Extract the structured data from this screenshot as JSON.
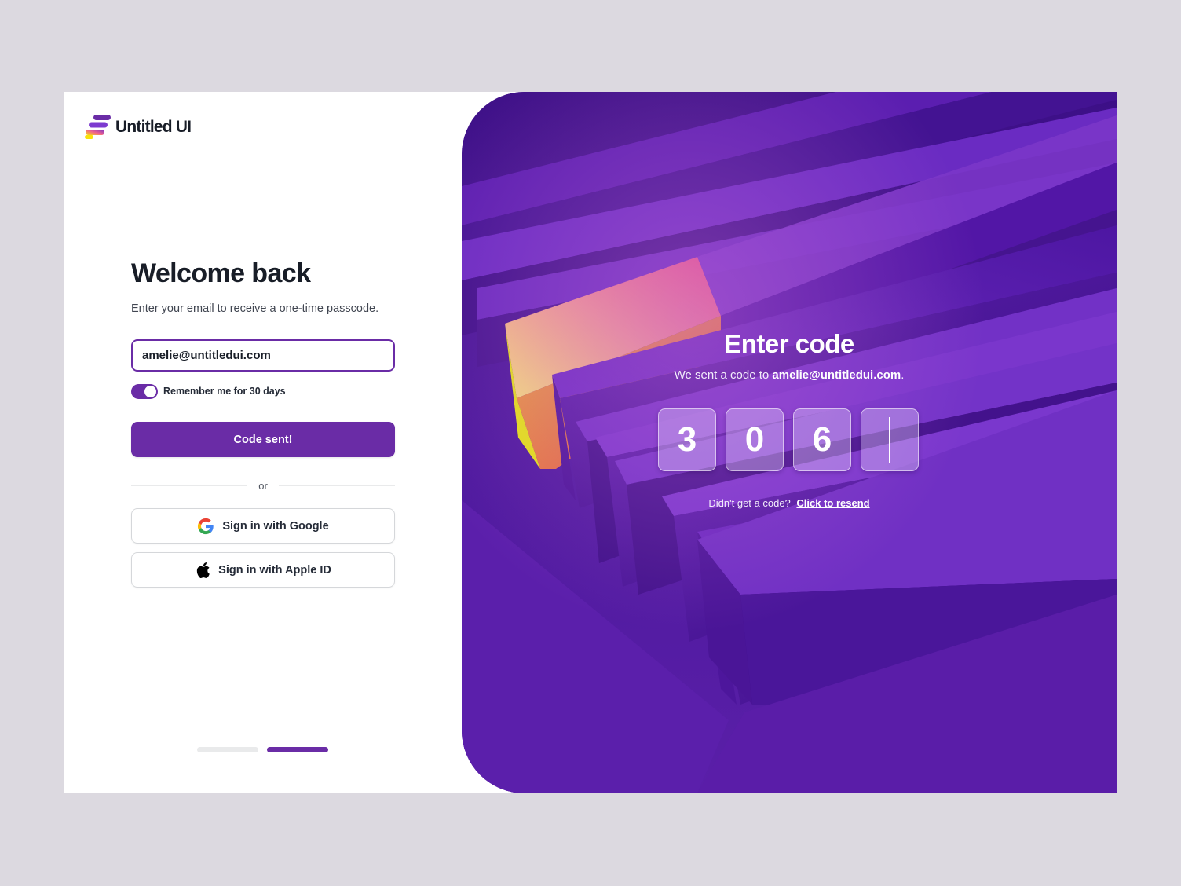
{
  "brand": {
    "name": "Untitled UI",
    "accent": "#6a2ca6"
  },
  "login": {
    "title": "Welcome back",
    "subtitle": "Enter your email to receive a one-time passcode.",
    "email_value": "amelie@untitledui.com",
    "remember_label": "Remember me for 30 days",
    "remember_on": true,
    "submit_label": "Code sent!",
    "divider_text": "or",
    "google_label": "Sign in with Google",
    "apple_label": "Sign in with Apple ID",
    "icons": [
      "google-logo-icon",
      "apple-logo-icon"
    ]
  },
  "pager": {
    "total": 2,
    "active_index": 1
  },
  "verify": {
    "title": "Enter code",
    "subtitle_prefix": "We sent a code to",
    "subtitle_email": "amelie@untitledui.com",
    "subtitle_suffix": ".",
    "digits": [
      "3",
      "0",
      "6",
      ""
    ],
    "resend_prompt": "Didn't get a code?",
    "resend_link": "Click to resend"
  }
}
